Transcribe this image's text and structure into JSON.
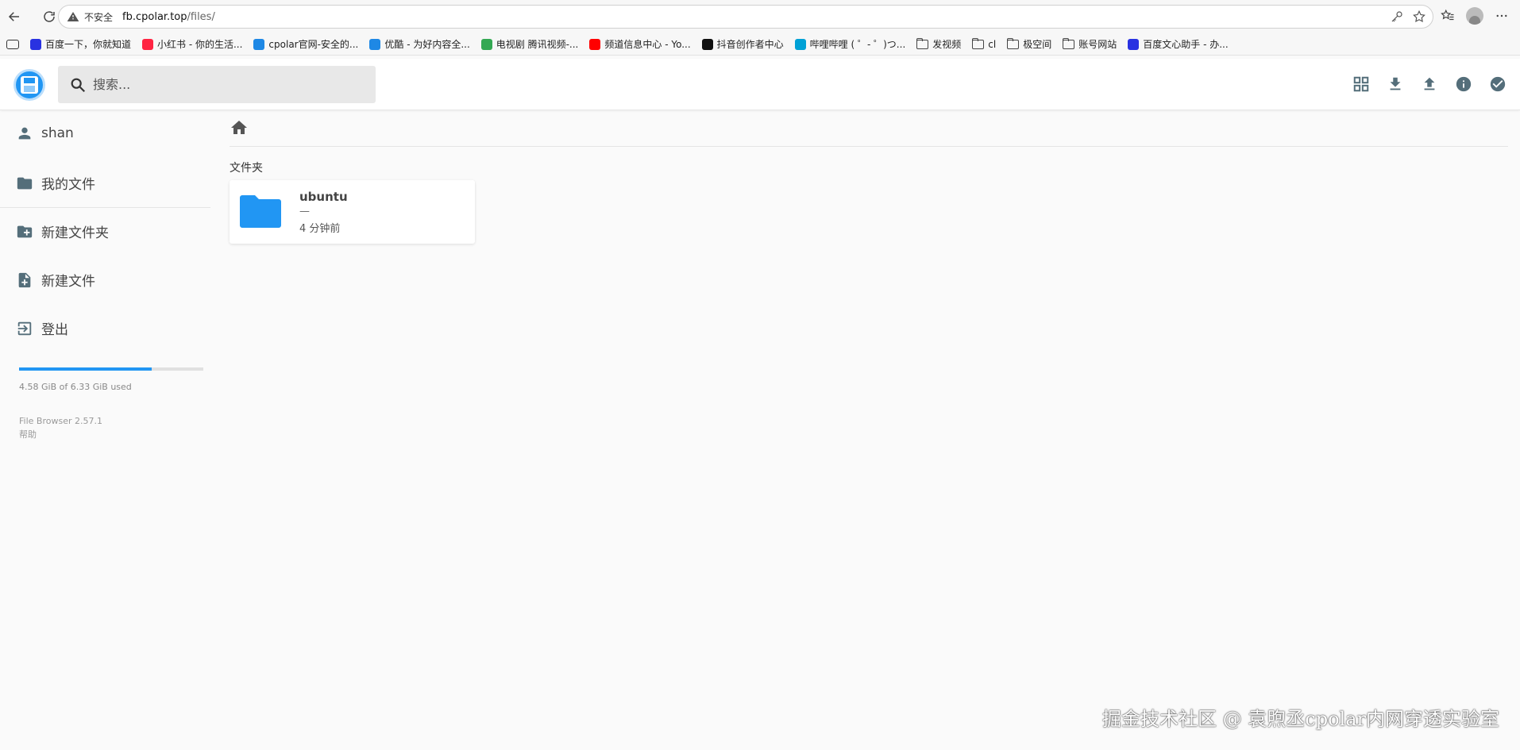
{
  "browser": {
    "insecure_label": "不安全",
    "url_host": "fb.cpolar.top",
    "url_path": "/files/"
  },
  "bookmarks": [
    {
      "label": "百度一下，你就知道",
      "color": "#2932e1",
      "icon": "paw-icon"
    },
    {
      "label": "小红书 - 你的生活...",
      "color": "#ff2442",
      "icon": "xiaohongshu-icon"
    },
    {
      "label": "cpolar官网-安全的...",
      "color": "#1e88e5",
      "icon": "search-icon"
    },
    {
      "label": "优酷 - 为好内容全...",
      "color": "#1e88e5",
      "icon": "play-icon"
    },
    {
      "label": "电视剧 腾讯视频-...",
      "color": "#34a853",
      "icon": "play-icon"
    },
    {
      "label": "频道信息中心 - Yo...",
      "color": "#ff0000",
      "icon": "youtube-icon"
    },
    {
      "label": "抖音创作者中心",
      "color": "#111111",
      "icon": "tiktok-icon"
    },
    {
      "label": "哔哩哔哩 ( ゜- ゜)つ...",
      "color": "#00a1d6",
      "icon": "bilibili-icon"
    },
    {
      "label": "发视频",
      "icon": "folder-icon"
    },
    {
      "label": "cl",
      "icon": "folder-icon"
    },
    {
      "label": "极空间",
      "icon": "folder-icon"
    },
    {
      "label": "账号网站",
      "icon": "folder-icon"
    },
    {
      "label": "百度文心助手 - 办...",
      "color": "#2932e1",
      "icon": "paw-icon"
    }
  ],
  "search": {
    "placeholder": "搜索..."
  },
  "sidebar": {
    "user": "shan",
    "my_files": "我的文件",
    "new_folder": "新建文件夹",
    "new_file": "新建文件",
    "logout": "登出",
    "usage_text": "4.58 GiB of 6.33 GiB used",
    "usage_fraction": 0.72,
    "version": "File Browser 2.57.1",
    "help": "帮助"
  },
  "main": {
    "section_title": "文件夹",
    "folder": {
      "name": "ubuntu",
      "size": "—",
      "modified": "4 分钟前"
    }
  },
  "colors": {
    "accent": "#2196f3",
    "icon_gray": "#546e7a"
  },
  "watermark": "掘金技术社区 @ 袁煦丞cpolar内网穿透实验室"
}
